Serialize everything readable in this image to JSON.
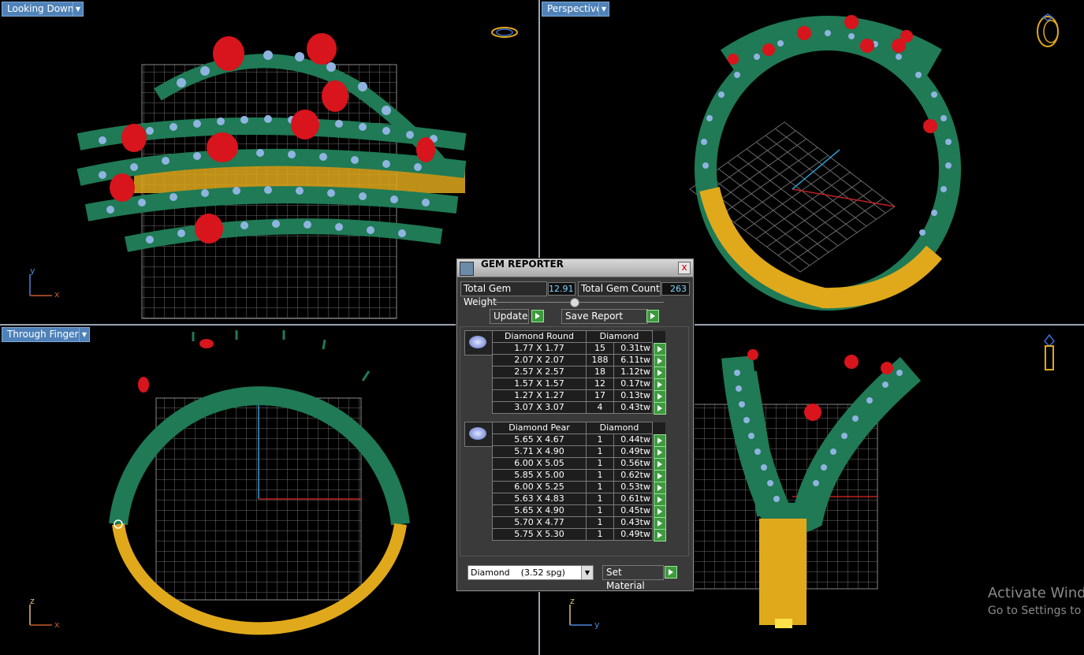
{
  "viewports": {
    "top_left": {
      "label": "Looking Down",
      "axis_v": "y",
      "axis_h": "x"
    },
    "top_right": {
      "label": "Perspective"
    },
    "bottom_left": {
      "label": "Through Finger",
      "axis_v": "z",
      "axis_h": "x"
    },
    "bottom_right": {
      "axis_v": "z",
      "axis_h": "y"
    }
  },
  "gem_reporter": {
    "title": "GEM REPORTER",
    "close_label": "x",
    "total_weight_label": "Total Gem Weight",
    "total_weight_value": "12.91",
    "total_count_label": "Total Gem Count",
    "total_count_value": "263",
    "update_label": "Update",
    "save_report_label": "Save Report",
    "round_group": {
      "shape_header": "Diamond Round",
      "material_header": "Diamond",
      "rows": [
        {
          "size": "1.77 X 1.77",
          "count": "15",
          "weight": "0.31tw"
        },
        {
          "size": "2.07 X 2.07",
          "count": "188",
          "weight": "6.11tw"
        },
        {
          "size": "2.57 X 2.57",
          "count": "18",
          "weight": "1.12tw"
        },
        {
          "size": "1.57 X 1.57",
          "count": "12",
          "weight": "0.17tw"
        },
        {
          "size": "1.27 X 1.27",
          "count": "17",
          "weight": "0.13tw"
        },
        {
          "size": "3.07 X 3.07",
          "count": "4",
          "weight": "0.43tw"
        }
      ]
    },
    "pear_group": {
      "shape_header": "Diamond Pear",
      "material_header": "Diamond",
      "rows": [
        {
          "size": "5.65 X 4.67",
          "count": "1",
          "weight": "0.44tw"
        },
        {
          "size": "5.71 X 4.90",
          "count": "1",
          "weight": "0.49tw"
        },
        {
          "size": "6.00 X 5.05",
          "count": "1",
          "weight": "0.56tw"
        },
        {
          "size": "5.85 X 5.00",
          "count": "1",
          "weight": "0.62tw"
        },
        {
          "size": "6.00 X 5.25",
          "count": "1",
          "weight": "0.53tw"
        },
        {
          "size": "5.63 X 4.83",
          "count": "1",
          "weight": "0.61tw"
        },
        {
          "size": "5.65 X 4.90",
          "count": "1",
          "weight": "0.45tw"
        },
        {
          "size": "5.70 X 4.77",
          "count": "1",
          "weight": "0.43tw"
        },
        {
          "size": "5.75 X 5.30",
          "count": "1",
          "weight": "0.49tw"
        }
      ]
    },
    "material_select": "Diamond    (3.52 spg)",
    "set_material_label": "Set Material"
  },
  "watermark": {
    "line1": "Activate Wind",
    "line2": "Go to Settings to"
  },
  "colors": {
    "metal_green": "#1f7a55",
    "gold": "#e0a91c",
    "ruby": "#d8141c",
    "diamond": "#8fb4e0",
    "grid": "#6b6b6b",
    "label_bg": "#4f82b8"
  }
}
